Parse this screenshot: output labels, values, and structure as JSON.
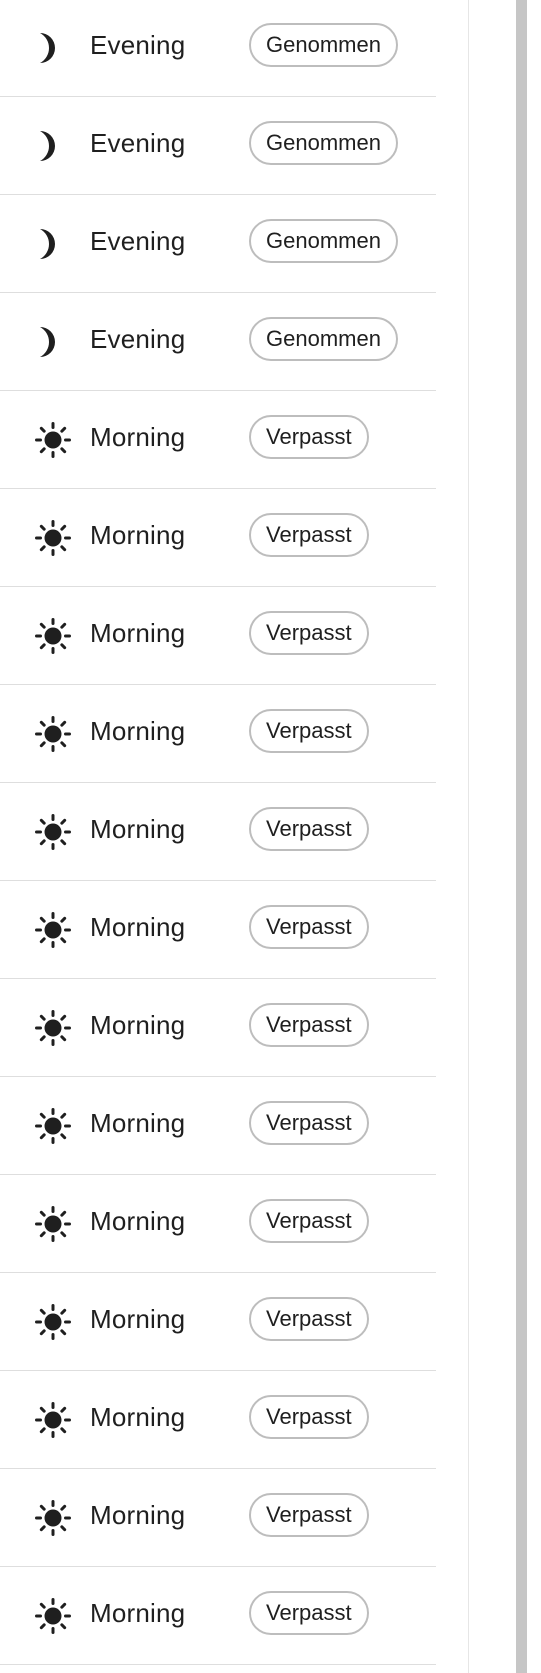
{
  "colors": {
    "text": "#1f1f1f",
    "chip_border": "#bdbdbd",
    "divider": "#dedede",
    "scrollbar": "#c6c6c6"
  },
  "rows": [
    {
      "period": "Evening",
      "icon": "moon-icon",
      "status": "Genommen"
    },
    {
      "period": "Evening",
      "icon": "moon-icon",
      "status": "Genommen"
    },
    {
      "period": "Evening",
      "icon": "moon-icon",
      "status": "Genommen"
    },
    {
      "period": "Evening",
      "icon": "moon-icon",
      "status": "Genommen"
    },
    {
      "period": "Morning",
      "icon": "sun-icon",
      "status": "Verpasst"
    },
    {
      "period": "Morning",
      "icon": "sun-icon",
      "status": "Verpasst"
    },
    {
      "period": "Morning",
      "icon": "sun-icon",
      "status": "Verpasst"
    },
    {
      "period": "Morning",
      "icon": "sun-icon",
      "status": "Verpasst"
    },
    {
      "period": "Morning",
      "icon": "sun-icon",
      "status": "Verpasst"
    },
    {
      "period": "Morning",
      "icon": "sun-icon",
      "status": "Verpasst"
    },
    {
      "period": "Morning",
      "icon": "sun-icon",
      "status": "Verpasst"
    },
    {
      "period": "Morning",
      "icon": "sun-icon",
      "status": "Verpasst"
    },
    {
      "period": "Morning",
      "icon": "sun-icon",
      "status": "Verpasst"
    },
    {
      "period": "Morning",
      "icon": "sun-icon",
      "status": "Verpasst"
    },
    {
      "period": "Morning",
      "icon": "sun-icon",
      "status": "Verpasst"
    },
    {
      "period": "Morning",
      "icon": "sun-icon",
      "status": "Verpasst"
    },
    {
      "period": "Morning",
      "icon": "sun-icon",
      "status": "Verpasst"
    }
  ]
}
